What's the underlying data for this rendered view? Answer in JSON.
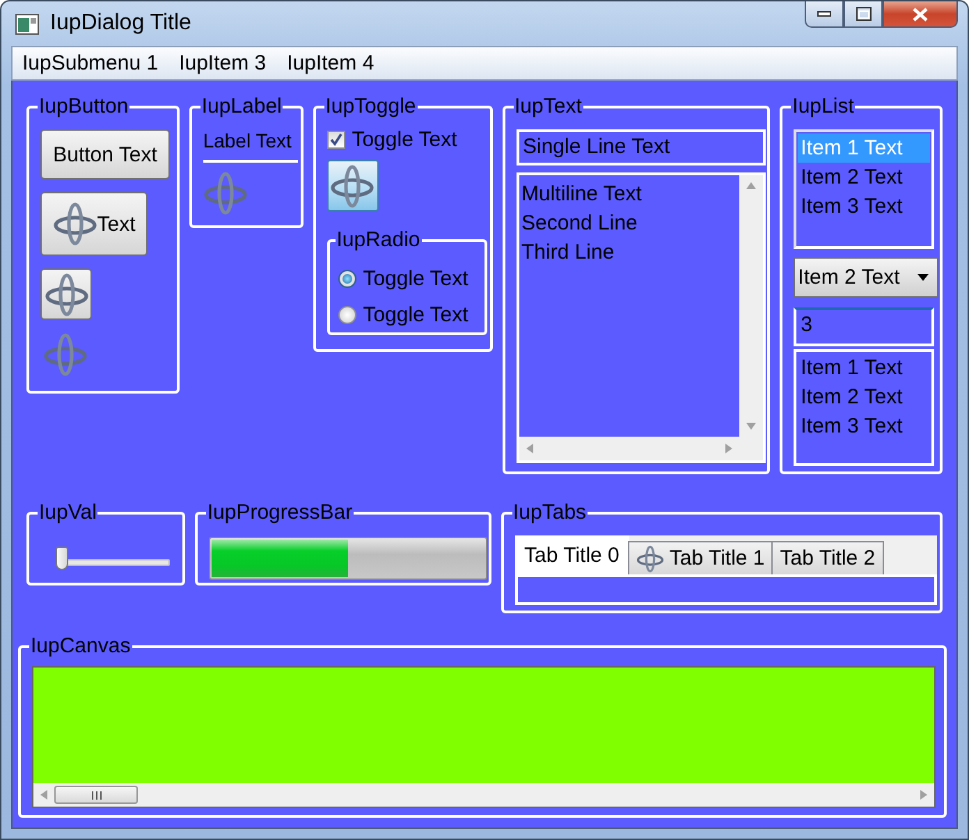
{
  "window": {
    "title": "IupDialog Title"
  },
  "menu": [
    "IupSubmenu 1",
    "IupItem 3",
    "IupItem 4"
  ],
  "button_group": {
    "title": "IupButton",
    "buttons": [
      {
        "kind": "text",
        "label": "Button Text"
      },
      {
        "kind": "icon_text",
        "label": "Text"
      },
      {
        "kind": "icon"
      },
      {
        "kind": "flat_icon"
      }
    ]
  },
  "label_group": {
    "title": "IupLabel",
    "label": "Label Text"
  },
  "toggle_group": {
    "title": "IupToggle",
    "toggle": {
      "label": "Toggle Text",
      "checked": true
    },
    "image_toggle": {
      "on": true
    },
    "radio": {
      "title": "IupRadio",
      "options": [
        {
          "label": "Toggle Text",
          "selected": true
        },
        {
          "label": "Toggle Text",
          "selected": false
        }
      ]
    }
  },
  "text_group": {
    "title": "IupText",
    "single_line": {
      "value": "Single Line Text"
    },
    "multiline": {
      "lines": [
        "Multiline Text",
        "Second Line",
        "Third Line"
      ]
    }
  },
  "list_group": {
    "title": "IupList",
    "list": [
      {
        "label": "Item 1 Text",
        "selected": true
      },
      {
        "label": "Item 2 Text",
        "selected": false
      },
      {
        "label": "Item 3 Text",
        "selected": false
      }
    ],
    "dropdown": {
      "value": "Item 2 Text"
    },
    "edit_list": {
      "value": "3",
      "items": [
        "Item 1 Text",
        "Item 2 Text",
        "Item 3 Text"
      ]
    }
  },
  "val_group": {
    "title": "IupVal",
    "level": 0.03
  },
  "progress_group": {
    "title": "IupProgressBar",
    "level": 0.5
  },
  "tabs_group": {
    "title": "IupTabs",
    "tabs": [
      {
        "label": "Tab Title 0",
        "selected": true,
        "icon": false
      },
      {
        "label": "Tab Title 1",
        "selected": false,
        "icon": true
      },
      {
        "label": "Tab Title 2",
        "selected": false,
        "icon": false
      }
    ]
  },
  "canvas_group": {
    "title": "IupCanvas"
  }
}
